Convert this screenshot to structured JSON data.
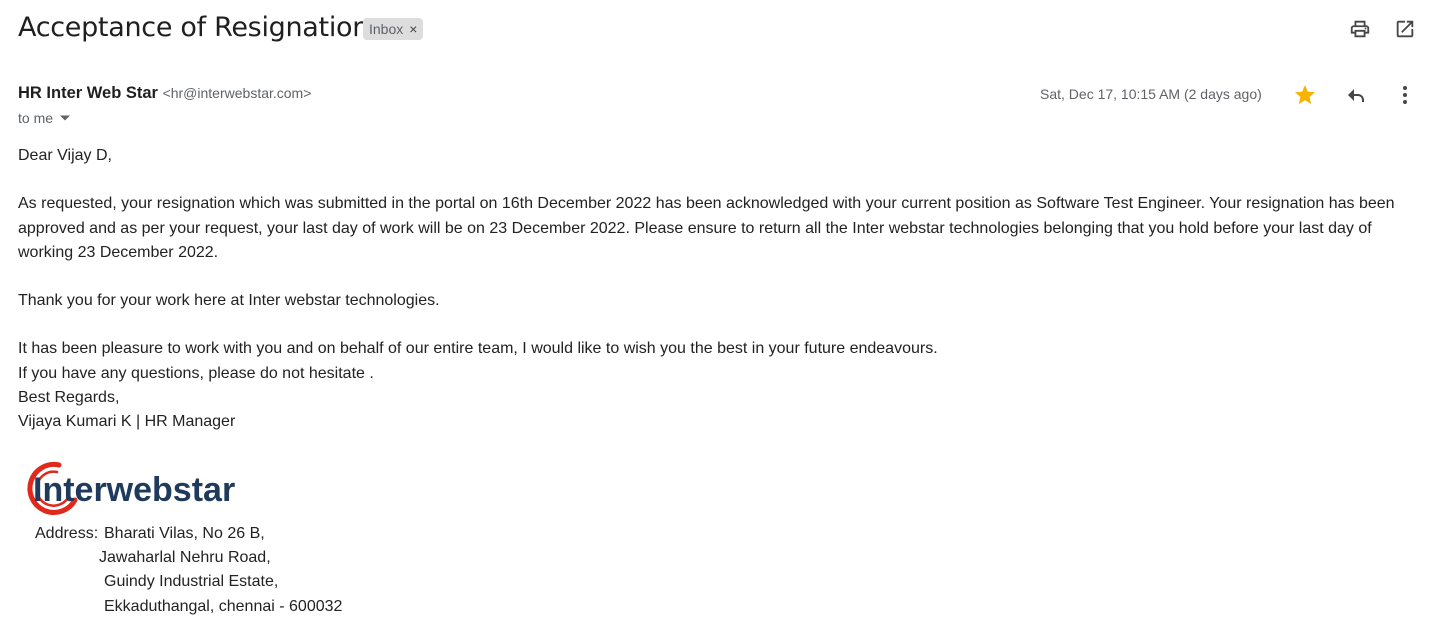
{
  "header": {
    "subject": "Acceptance of Resignation",
    "label": "Inbox",
    "label_remove": "×"
  },
  "message": {
    "sender_name": "HR Inter Web Star",
    "sender_email": "<hr@interwebstar.com>",
    "recipient": "to me",
    "date": "Sat, Dec 17, 10:15 AM (2 days ago)",
    "starred": true
  },
  "icons": {
    "print": "print-icon",
    "popout": "open-in-new-window-icon",
    "star": "star-icon",
    "reply": "reply-icon",
    "more": "more-vert-icon",
    "star_color": "#f4b400"
  },
  "body": {
    "greeting": "Dear Vijay D,",
    "para1": "As requested, your resignation which was submitted in the portal on  16th December 2022 has been acknowledged with your current position as  Software Test Engineer. Your resignation has been approved and as per your request, your last day of work will be on 23 December 2022. Please ensure to return all the Inter webstar technologies belonging that you hold before your last day of working 23 December 2022.",
    "para2": "Thank you for your work here at Inter webstar technologies.",
    "line1": "It has been pleasure to work with you and on behalf of our entire team, I would like to wish you the best in your future endeavours.",
    "line2": "If you have any questions, please do not hesitate .",
    "closing": "Best Regards,",
    "signature": "Vijaya Kumari K | HR Manager"
  },
  "footer": {
    "logo_text": "Interwebstar",
    "logo_color_red": "#e0281c",
    "logo_color_navy": "#1f3a5c",
    "address_label": "Address:",
    "address_line1": "Bharati Vilas, No 26 B,",
    "address_line2": "Jawaharlal Nehru Road,",
    "address_line3": "Guindy Industrial Estate,",
    "address_line4": "Ekkaduthangal, chennai - 600032"
  }
}
